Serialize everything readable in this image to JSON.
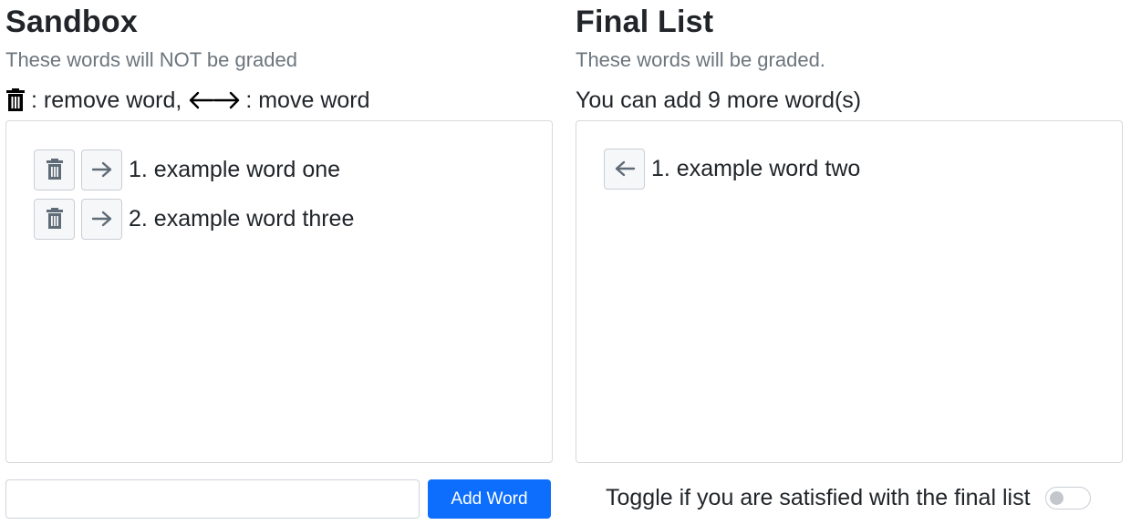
{
  "sandbox": {
    "title": "Sandbox",
    "subtitle": "These words will NOT be graded",
    "legend_remove": ": remove word,",
    "legend_move": ": move word",
    "items": [
      {
        "text": "1. example word one",
        "remove_icon": "trash-icon",
        "move_icon": "arrow-right-icon"
      },
      {
        "text": "2. example word three",
        "remove_icon": "trash-icon",
        "move_icon": "arrow-right-icon"
      }
    ],
    "input": {
      "value": "",
      "placeholder": ""
    },
    "add_button_label": "Add Word",
    "add_button_color": "#0d6efd"
  },
  "final": {
    "title": "Final List",
    "subtitle": "These words will be graded.",
    "capacity_text": "You can add 9 more word(s)",
    "items": [
      {
        "text": "1. example word two",
        "move_icon": "arrow-left-icon"
      }
    ],
    "toggle_label": "Toggle if you are satisfied with the final list",
    "toggle_on": false
  }
}
